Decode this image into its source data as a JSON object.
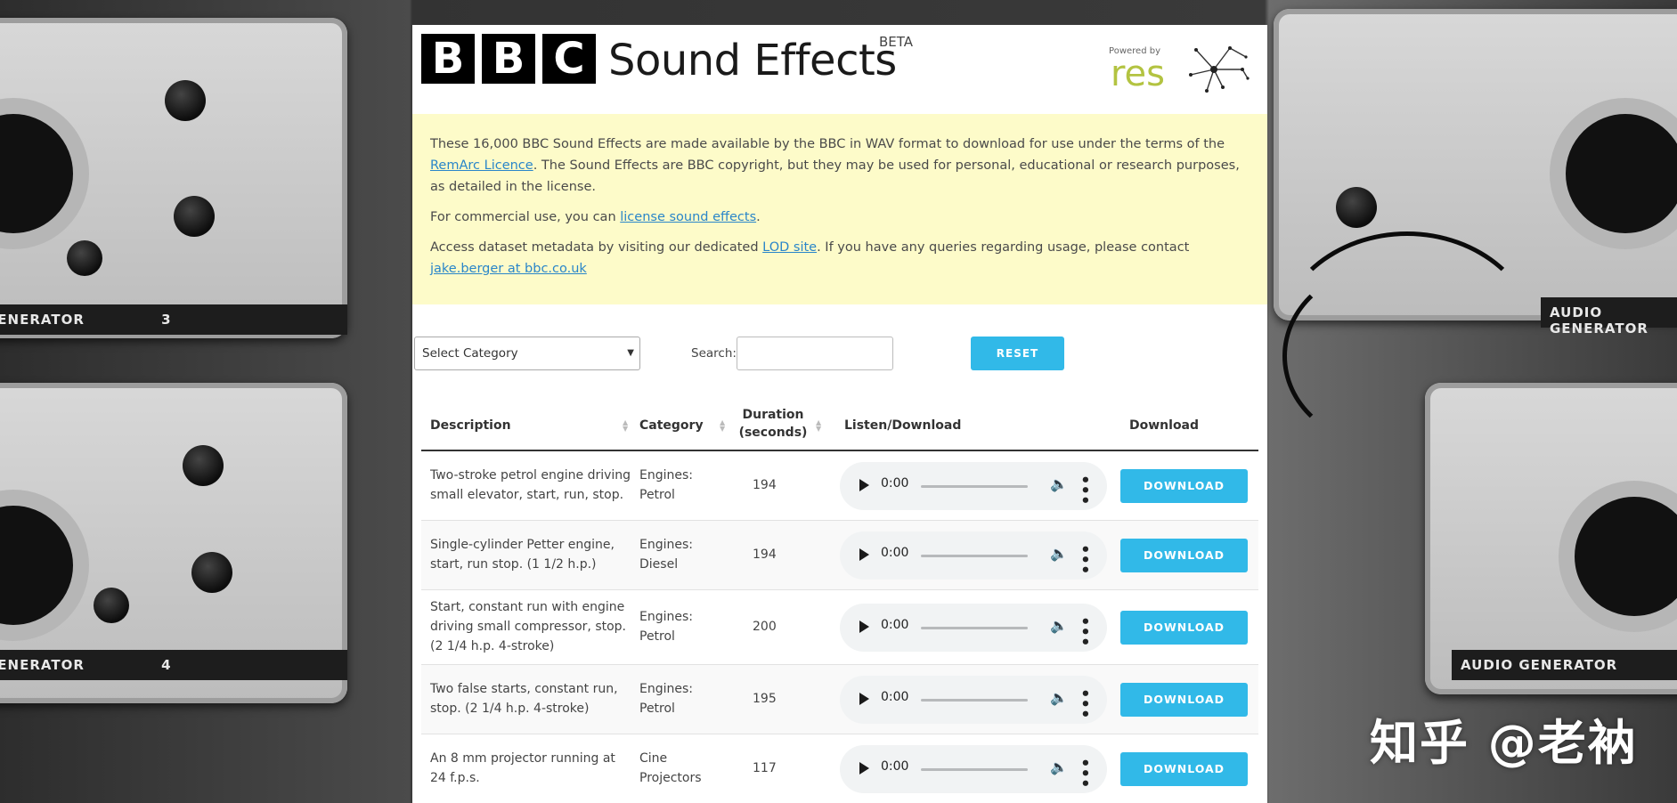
{
  "header": {
    "bbc_letters": [
      "B",
      "B",
      "C"
    ],
    "product_name": "Sound Effects",
    "beta_label": "BETA",
    "powered_by": "Powered by",
    "res_logo": "res"
  },
  "notice": {
    "p1_before": "These 16,000 BBC Sound Effects are made available by the BBC in WAV format to download for use under the terms of the ",
    "p1_link": "RemArc Licence",
    "p1_after": ". The Sound Effects are BBC copyright, but they may be used for personal, educational or research purposes, as detailed in the license.",
    "p2_before": "For commercial use, you can ",
    "p2_link": "license sound effects",
    "p2_after": ".",
    "p3_before": "Access dataset metadata by visiting our dedicated ",
    "p3_link1": "LOD site",
    "p3_middle": ". If you have any queries regarding usage, please contact ",
    "p3_link2": "jake.berger at bbc.co.uk"
  },
  "controls": {
    "category_selected": "Select Category",
    "search_label": "Search:",
    "search_value": "",
    "reset_label": "RESET"
  },
  "table": {
    "headers": {
      "description": "Description",
      "category": "Category",
      "duration_line1": "Duration",
      "duration_line2": "(seconds)",
      "listen": "Listen/Download",
      "download": "Download"
    },
    "rows": [
      {
        "description": "Two-stroke petrol engine driving small elevator, start, run, stop.",
        "category": "Engines: Petrol",
        "duration": "194",
        "time": "0:00",
        "download": "DOWNLOAD"
      },
      {
        "description": "Single-cylinder Petter engine, start, run stop. (1 1/2 h.p.)",
        "category": "Engines: Diesel",
        "duration": "194",
        "time": "0:00",
        "download": "DOWNLOAD"
      },
      {
        "description": "Start, constant run with engine driving small compressor, stop. (2 1/4 h.p. 4-stroke)",
        "category": "Engines: Petrol",
        "duration": "200",
        "time": "0:00",
        "download": "DOWNLOAD"
      },
      {
        "description": "Two false starts, constant run, stop. (2 1/4 h.p. 4-stroke)",
        "category": "Engines: Petrol",
        "duration": "195",
        "time": "0:00",
        "download": "DOWNLOAD"
      },
      {
        "description": "An 8 mm projector running at 24 f.p.s.",
        "category": "Cine Projectors",
        "duration": "117",
        "time": "0:00",
        "download": "DOWNLOAD"
      }
    ]
  },
  "background": {
    "device_labels": [
      "GENERATOR",
      "3",
      "GENERATOR",
      "4",
      "AUDIO GENERATOR",
      "AUDIO GENERATOR"
    ]
  },
  "watermark": "知乎 @老衲",
  "colors": {
    "accent": "#31b9e8",
    "notice_bg": "#fdfbc9",
    "link": "#2a86c9",
    "res_green": "#b3c341"
  }
}
